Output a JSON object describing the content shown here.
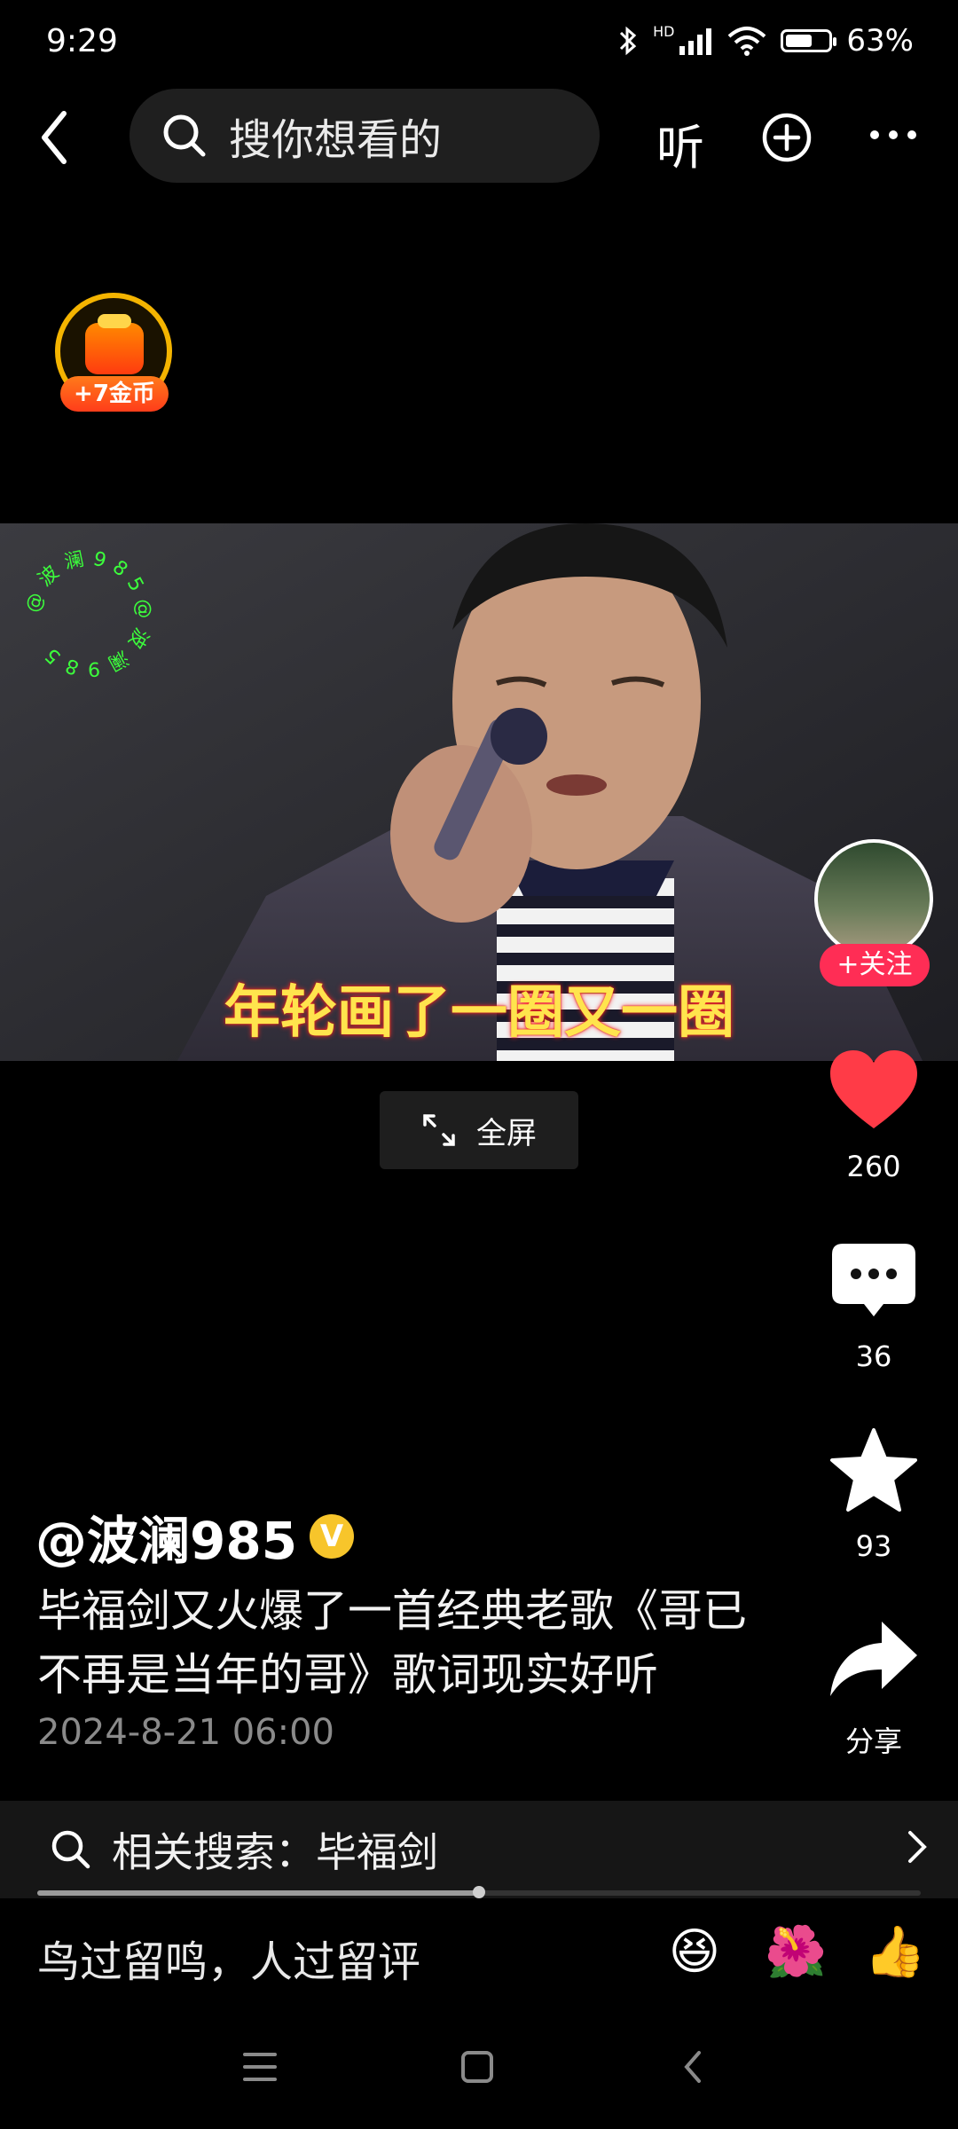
{
  "status_bar": {
    "time": "9:29",
    "network": "HD",
    "battery_percent": 63,
    "battery_label": "63%"
  },
  "top_bar": {
    "search_placeholder": "搜你想看的",
    "listen_label": "听"
  },
  "coin_badge": {
    "label": "+7金币"
  },
  "video": {
    "watermark_text": "@波澜985",
    "subtitle": "年轮画了一圈又一圈",
    "fullscreen_label": "全屏"
  },
  "actions": {
    "follow_label": "+关注",
    "likes": "260",
    "comments": "36",
    "favorites": "93",
    "share_label": "分享"
  },
  "post": {
    "author": "@波澜985",
    "verified_mark": "V",
    "caption": "毕福剑又火爆了一首经典老歌《哥已不再是当年的哥》歌词现实好听",
    "date": "2024-8-21 06:00"
  },
  "related_search": {
    "label": "相关搜索：毕福剑"
  },
  "playback": {
    "progress": 0.5
  },
  "comment_bar": {
    "placeholder": "鸟过留鸣，人过留评",
    "emojis": [
      "😆",
      "🌺",
      "👍"
    ]
  },
  "colors": {
    "like": "#ff3b47",
    "follow": "#ff2d55",
    "coin_ring": "#f4b400",
    "subtitle": "#ffe44d"
  }
}
